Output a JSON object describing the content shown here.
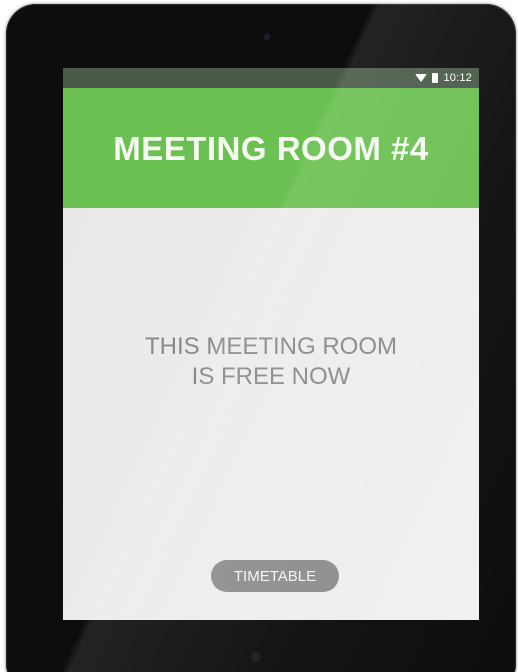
{
  "status_bar": {
    "time": "10:12",
    "icons": [
      "wifi-icon",
      "battery-icon"
    ]
  },
  "header": {
    "title": "MEETING ROOM #4"
  },
  "main": {
    "message_line1": "THIS MEETING ROOM",
    "message_line2": "IS FREE NOW",
    "timetable_label": "TIMETABLE"
  },
  "colors": {
    "header_green": "#6ac051",
    "status_bar": "#4a5a48",
    "background": "#ececec",
    "button": "#8e8e8e",
    "message_text": "#8a8a8a"
  }
}
